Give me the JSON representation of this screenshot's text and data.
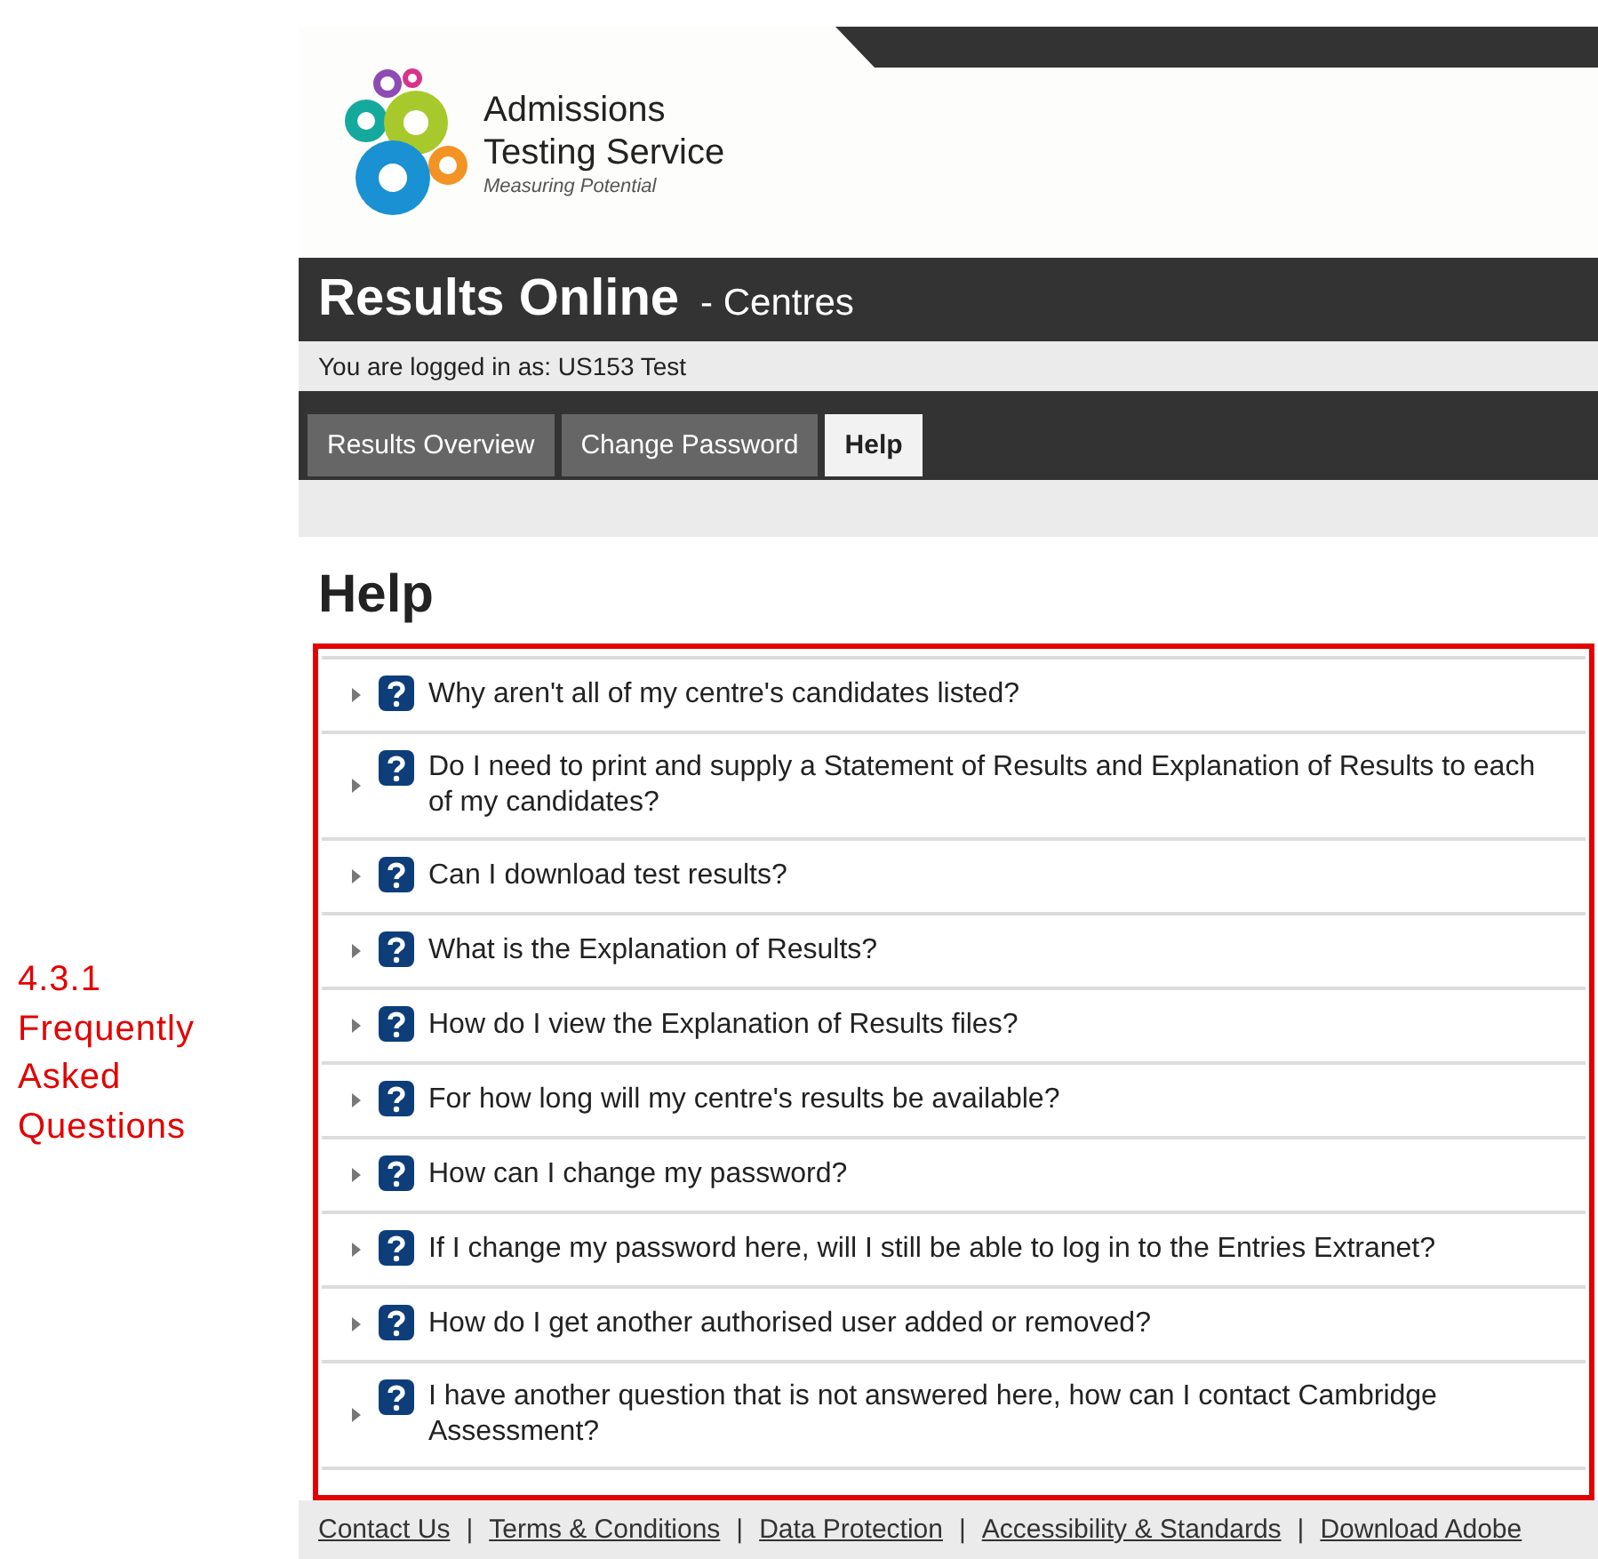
{
  "annotation": {
    "heading": "4.3.1 Frequently Asked Questions"
  },
  "header": {
    "logo_lines": [
      "Admissions",
      "Testing Service"
    ],
    "tagline": "Measuring Potential"
  },
  "title_bar": {
    "title": "Results Online",
    "subtitle": "- Centres"
  },
  "login_bar": {
    "text": "You are logged in as: US153 Test"
  },
  "tabs": [
    {
      "label": "Results Overview",
      "selected": false
    },
    {
      "label": "Change Password",
      "selected": false
    },
    {
      "label": "Help",
      "selected": true
    }
  ],
  "page": {
    "heading": "Help"
  },
  "faq": [
    {
      "question": "Why aren't all of my centre's candidates listed?",
      "expanded": false
    },
    {
      "question": "Do I need to print and supply a Statement of Results and Explanation of Results to each of my candidates?",
      "expanded": false
    },
    {
      "question": "Can I download test results?",
      "expanded": false
    },
    {
      "question": "What is the Explanation of Results?",
      "expanded": false
    },
    {
      "question": "How do I view the Explanation of Results files?",
      "expanded": false
    },
    {
      "question": "For how long will my centre's results be available?",
      "expanded": false
    },
    {
      "question": "How can I change my password?",
      "expanded": false
    },
    {
      "question": "If I change my password here, will I still be able to log in to the Entries Extranet?",
      "expanded": false
    },
    {
      "question": "How do I get another authorised user added or removed?",
      "expanded": false
    },
    {
      "question": "I have another question that is not answered here, how can I contact Cambridge Assessment?",
      "expanded": false
    }
  ],
  "footer": [
    {
      "kind": "link",
      "text": "Contact Us"
    },
    {
      "kind": "separator",
      "text": "|"
    },
    {
      "kind": "link",
      "text": "Terms & Conditions"
    },
    {
      "kind": "separator",
      "text": "|"
    },
    {
      "kind": "link",
      "text": "Data Protection"
    },
    {
      "kind": "separator",
      "text": "|"
    },
    {
      "kind": "link",
      "text": "Accessibility & Standards"
    },
    {
      "kind": "separator",
      "text": "|"
    },
    {
      "kind": "link",
      "text": "Download Adobe"
    }
  ]
}
